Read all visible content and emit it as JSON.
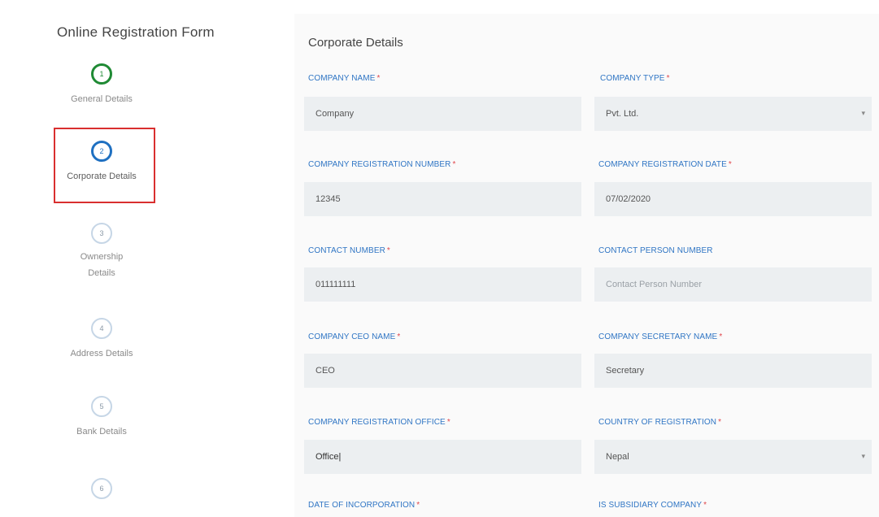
{
  "page_title": "Online Registration Form",
  "steps": [
    {
      "number": "1",
      "label": "General Details",
      "state": "done"
    },
    {
      "number": "2",
      "label": "Corporate Details",
      "state": "active"
    },
    {
      "number": "3",
      "label": "Ownership Details",
      "state": "pending"
    },
    {
      "number": "4",
      "label": "Address Details",
      "state": "pending"
    },
    {
      "number": "5",
      "label": "Bank Details",
      "state": "pending"
    },
    {
      "number": "6",
      "label": "",
      "state": "pending"
    }
  ],
  "section_title": "Corporate Details",
  "required_mark": "*",
  "fields": {
    "company_name": {
      "label": "COMPANY NAME",
      "value": "Company",
      "required": true
    },
    "company_type": {
      "label": "COMPANY TYPE",
      "value": "Pvt. Ltd.",
      "required": true
    },
    "company_registration_number": {
      "label": "COMPANY REGISTRATION NUMBER",
      "value": "12345",
      "required": true
    },
    "company_registration_date": {
      "label": "COMPANY REGISTRATION DATE",
      "value": "07/02/2020",
      "required": true
    },
    "contact_number": {
      "label": "CONTACT NUMBER",
      "value": "011111111",
      "required": true
    },
    "contact_person_number": {
      "label": "CONTACT PERSON NUMBER",
      "placeholder": "Contact Person Number",
      "required": false
    },
    "company_ceo_name": {
      "label": "COMPANY CEO NAME",
      "value": "CEO",
      "required": true
    },
    "company_secretary_name": {
      "label": "COMPANY SECRETARY NAME",
      "value": "Secretary",
      "required": true
    },
    "company_registration_office": {
      "label": "COMPANY REGISTRATION OFFICE",
      "value": "Office",
      "required": true
    },
    "country_of_registration": {
      "label": "COUNTRY OF REGISTRATION",
      "value": "Nepal",
      "required": true
    },
    "date_of_incorporation": {
      "label": "DATE OF INCORPORATION",
      "required": true
    },
    "is_subsidiary_company": {
      "label": "IS SUBSIDIARY COMPANY",
      "required": true
    }
  },
  "icons": {
    "dropdown_arrow": "chevron-down-icon"
  },
  "colors": {
    "accent": "#2f75c4",
    "step_done": "#1f8a34",
    "step_active": "#1f70c1",
    "highlight_box": "#d92f2f",
    "required": "#e0474c"
  }
}
